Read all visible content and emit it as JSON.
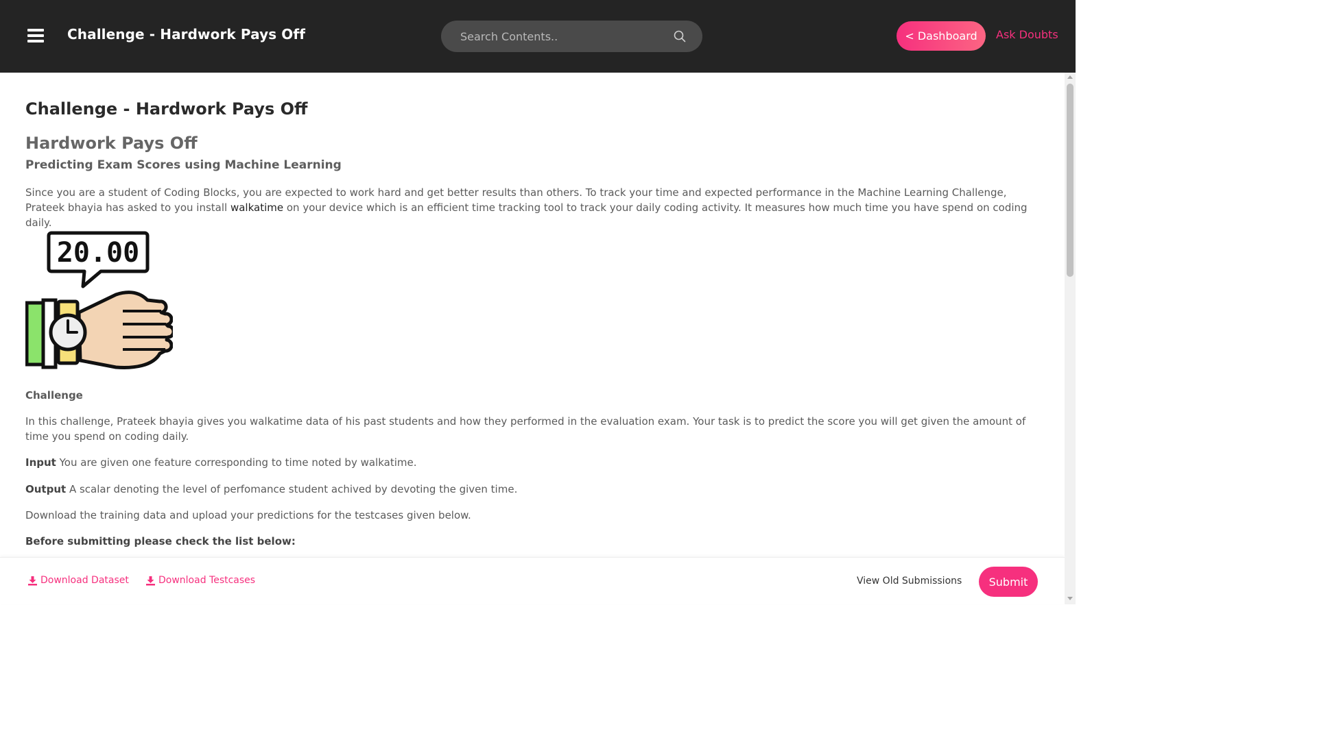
{
  "header": {
    "title": "Challenge - Hardwork Pays Off",
    "search_placeholder": "Search Contents..",
    "dashboard_label": "< Dashboard",
    "ask_doubts_label": "Ask Doubts"
  },
  "main": {
    "page_title": "Challenge - Hardwork Pays Off",
    "heading": "Hardwork Pays Off",
    "subheading": "Predicting Exam Scores using Machine Learning",
    "intro_before": "Since you are a student of Coding Blocks, you are expected to work hard and get better results than others. To track your time and expected performance in the Machine Learning Challenge, Prateek bhayia has asked to you install ",
    "intro_link": "walkatime",
    "intro_after": " on your device which is an efficient time tracking tool to track your daily coding activity. It measures how much time you have spend on coding daily.",
    "illustration_time": "20.00",
    "challenge_heading": "Challenge",
    "challenge_text": "In this challenge, Prateek bhayia gives you walkatime data of his past students and how they performed in the evaluation exam. Your task is to predict the score you will get given the amount of time you spend on coding daily.",
    "input_label": "Input",
    "input_text": " You are given one feature corresponding to time noted by walkatime.",
    "output_label": "Output",
    "output_text": " A scalar denoting the level of perfomance student achived by devoting the given time.",
    "download_text": "Download the training data and upload your predictions for the testcases given below.",
    "checklist_heading": "Before submitting please check the list below:"
  },
  "footer": {
    "download_dataset": "Download Dataset",
    "download_testcases": "Download Testcases",
    "view_old_submissions": "View Old Submissions",
    "submit": "Submit"
  },
  "colors": {
    "accent": "#f6307e",
    "topbar": "#242424"
  }
}
